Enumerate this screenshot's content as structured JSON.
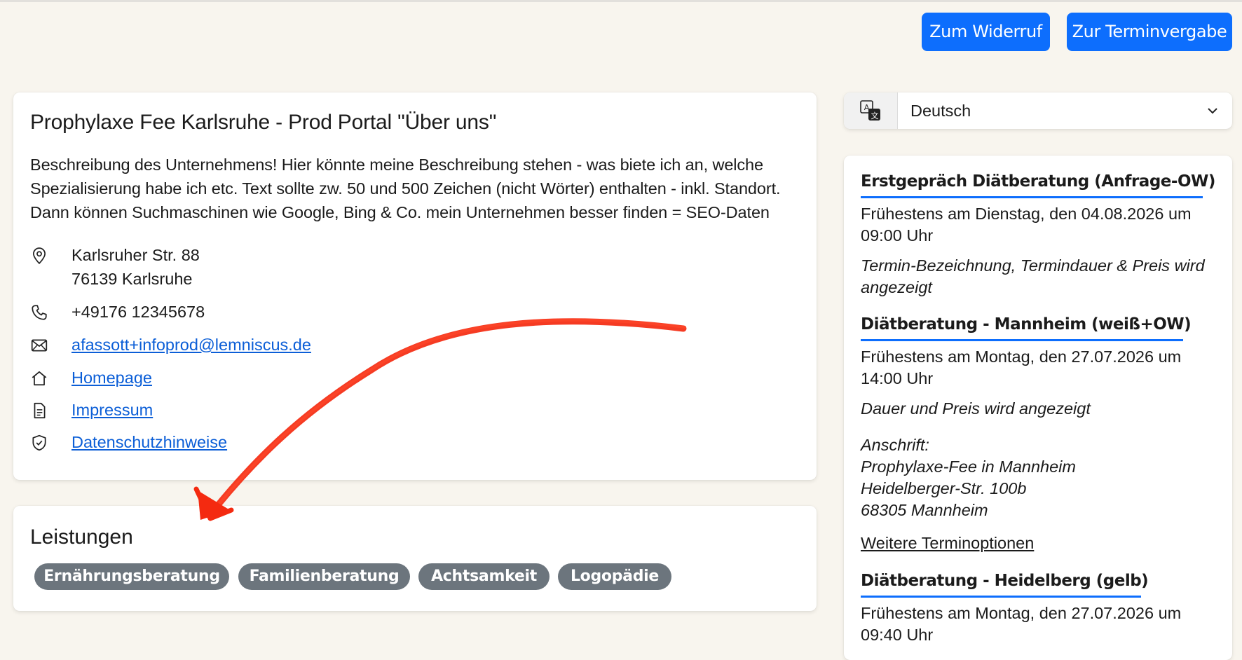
{
  "header": {
    "revoke_button": "Zum Widerruf",
    "booking_button": "Zur Terminvergabe"
  },
  "about": {
    "title": "Prophylaxe Fee Karlsruhe - Prod Portal \"Über uns\"",
    "description_lines": [
      "Beschreibung des Unternehmens! Hier könnte meine Beschreibung stehen - was biete ich an, welche",
      "Spezialisierung habe ich etc. Text sollte zw. 50 und 500 Zeichen (nicht Wörter) enthalten - inkl. Standort.",
      "Dann können Suchmaschinen wie Google, Bing & Co. mein Unternehmen besser finden = SEO-Daten"
    ],
    "address_line1": "Karlsruher Str. 88",
    "address_line2": "76139 Karlsruhe",
    "phone": "+49176 12345678",
    "email": "afassott+infoprod@lemniscus.de",
    "homepage": "Homepage",
    "imprint": "Impressum",
    "privacy": "Datenschutzhinweise"
  },
  "services": {
    "title": "Leistungen",
    "tags": [
      "Ernährungsberatung",
      "Familienberatung",
      "Achtsamkeit",
      "Logopädie"
    ]
  },
  "language": {
    "selected": "Deutsch"
  },
  "appointments": [
    {
      "title": "Erstgepräch Diätberatung (Anfrage-OW)",
      "earliest_line1": "Frühestens am Dienstag, den 04.08.2026 um",
      "earliest_line2": "09:00 Uhr",
      "note_line1": "Termin-Bezeichnung, Termindauer & Preis wird",
      "note_line2": "angezeigt"
    },
    {
      "title": "Diätberatung - Mannheim (weiß+OW)",
      "earliest_line1": "Frühestens am Montag, den 27.07.2026 um",
      "earliest_line2": "14:00 Uhr",
      "note": "Dauer und Preis wird angezeigt",
      "address_label": "Anschrift:",
      "address_lines": [
        "Prophylaxe-Fee in Mannheim",
        "Heidelberger-Str. 100b",
        "68305 Mannheim"
      ],
      "more_options": "Weitere Terminoptionen"
    },
    {
      "title": "Diätberatung - Heidelberg (gelb)",
      "earliest_line1": "Frühestens am Montag, den 27.07.2026 um",
      "earliest_line2": "09:40 Uhr"
    }
  ],
  "colors": {
    "background": "#f8f5ee",
    "primary": "#0d6efd",
    "link": "#0b5ed7",
    "tag": "#6c757d",
    "annotation": "#f42a10"
  },
  "icons": [
    "location-pin-icon",
    "phone-icon",
    "envelope-icon",
    "house-icon",
    "document-icon",
    "shield-icon",
    "translate-icon",
    "chevron-down-icon"
  ]
}
